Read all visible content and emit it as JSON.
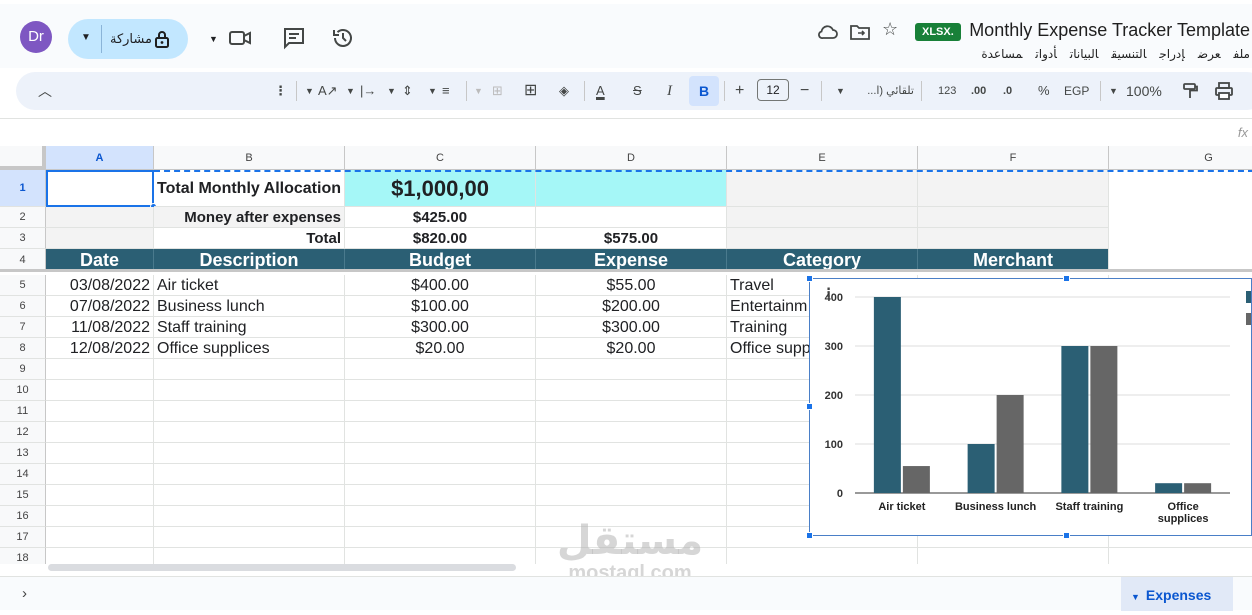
{
  "account": {
    "avatar_initials": "Dr",
    "avatar_color": "#7e57c2"
  },
  "share": {
    "label": "مشاركة"
  },
  "document": {
    "title": "Monthly Expense Tracker Template",
    "format_badge": "XLSX."
  },
  "menu": [
    "ملف",
    "عرض",
    "إدراج",
    "التنسيق",
    "البيانات",
    "أدوات",
    "مساعدة"
  ],
  "toolbar": {
    "zoom": "100%",
    "currency": "EGP",
    "percent": "%",
    "decrease_decimals": ".0",
    "increase_decimals": ".00",
    "number_format": "123",
    "font_name": "تلقائي (ا...",
    "font_size": "12",
    "minus": "−",
    "plus": "+",
    "bold": "B",
    "italic": "I"
  },
  "formula_bar": {
    "fx": "fx"
  },
  "columns": [
    "A",
    "B",
    "C",
    "D",
    "E",
    "F",
    "G"
  ],
  "rows": [
    "1",
    "2",
    "3",
    "4",
    "5",
    "6",
    "7",
    "8",
    "9",
    "10",
    "11",
    "12",
    "13",
    "14",
    "15",
    "16",
    "17",
    "18"
  ],
  "sheet": {
    "r1": {
      "label": "Total Monthly Allocation",
      "value": "$1,000,00"
    },
    "r2": {
      "label": "Money after expenses",
      "value": "$425.00"
    },
    "r3": {
      "label": "Total",
      "budget_total": "$820.00",
      "expense_total": "$575.00"
    },
    "headers": [
      "Date",
      "Description",
      "Budget",
      "Expense",
      "Category",
      "Merchant"
    ],
    "data": [
      {
        "date": "03/08/2022",
        "desc": "Air ticket",
        "budget": "$400.00",
        "expense": "$55.00",
        "category": "Travel"
      },
      {
        "date": "07/08/2022",
        "desc": "Business lunch",
        "budget": "$100.00",
        "expense": "$200.00",
        "category": "Entertainm"
      },
      {
        "date": "11/08/2022",
        "desc": "Staff training",
        "budget": "$300.00",
        "expense": "$300.00",
        "category": "Training"
      },
      {
        "date": "12/08/2022",
        "desc": "Office supplices",
        "budget": "$20.00",
        "expense": "$20.00",
        "category": "Office supp"
      }
    ],
    "header_color": "#2b5f74",
    "highlight_color": "#a5f7f7"
  },
  "sheet_tab": {
    "label": "Expenses"
  },
  "watermark": {
    "line1": "مستقل",
    "line2": "mostaql.com"
  },
  "chart_data": {
    "type": "bar",
    "categories": [
      "Air ticket",
      "Business lunch",
      "Staff training",
      "Office supplices"
    ],
    "series": [
      {
        "values": [
          400,
          100,
          300,
          20
        ],
        "color": "#2b5f74"
      },
      {
        "values": [
          55,
          200,
          300,
          20
        ],
        "color": "#666666"
      }
    ],
    "yticks": [
      "0",
      "100",
      "200",
      "300",
      "400"
    ],
    "ylim": [
      0,
      400
    ]
  }
}
